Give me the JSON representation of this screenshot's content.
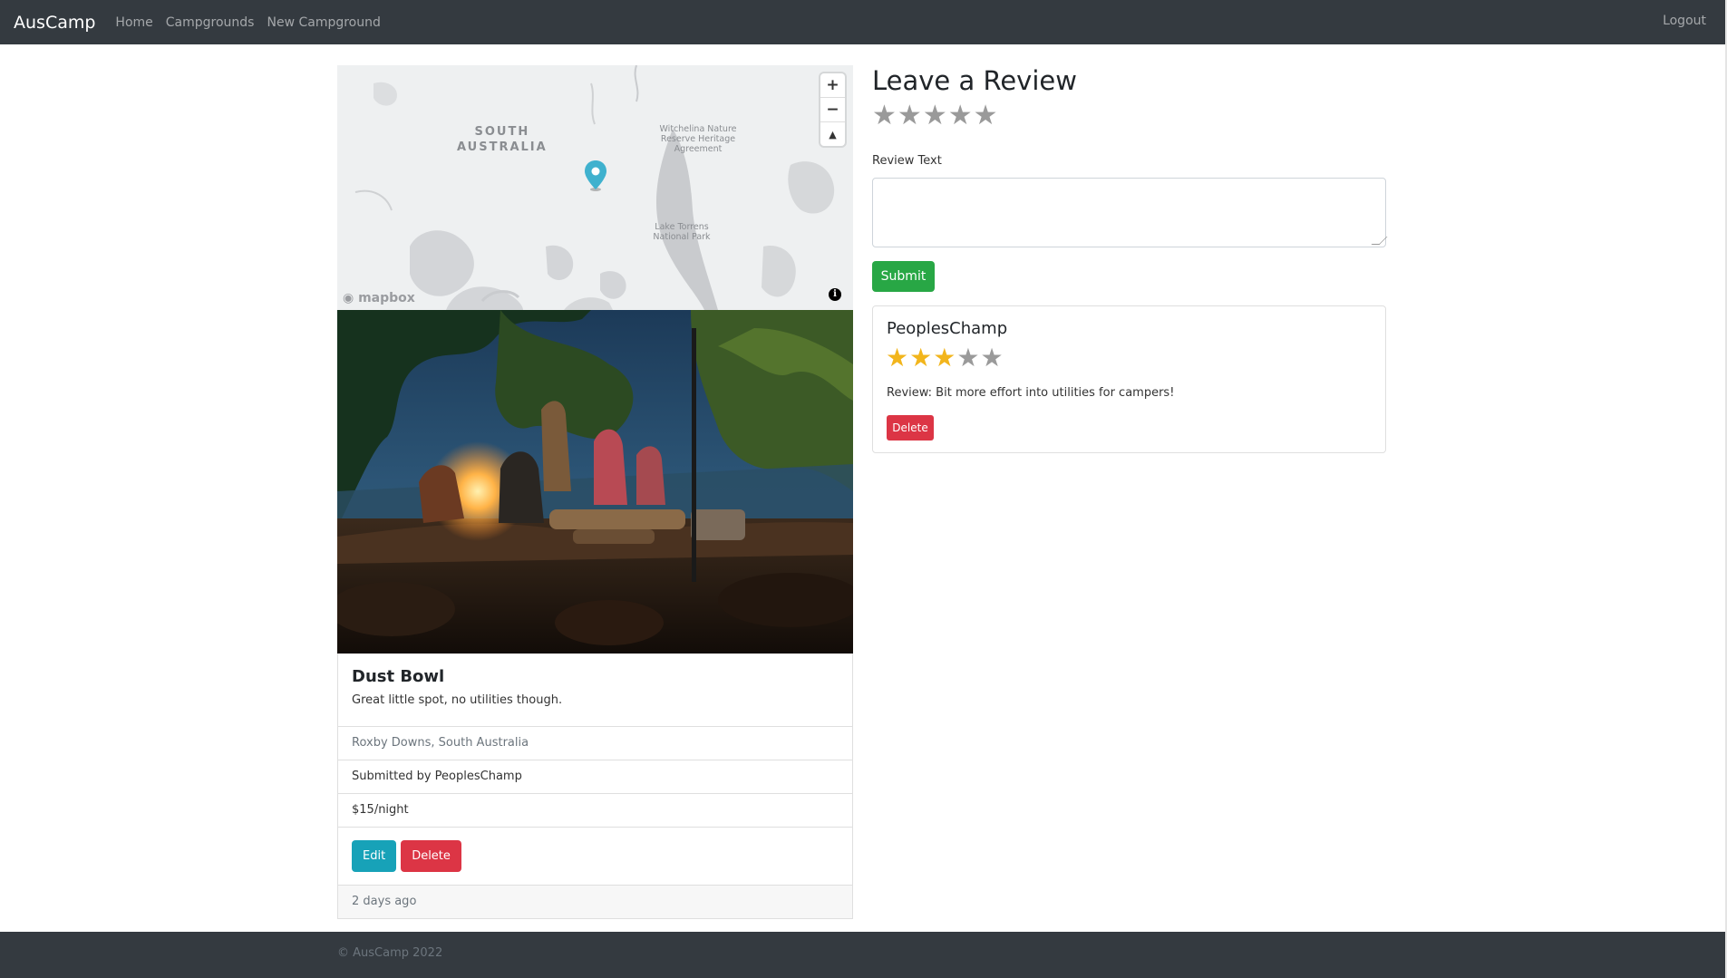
{
  "navbar": {
    "brand": "AusCamp",
    "links": [
      "Home",
      "Campgrounds",
      "New Campground"
    ],
    "logout": "Logout"
  },
  "map": {
    "region_label_line1": "SOUTH",
    "region_label_line2": "AUSTRALIA",
    "poi1_line1": "Witchelina Nature",
    "poi1_line2": "Reserve Heritage",
    "poi1_line3": "Agreement",
    "poi2_line1": "Lake Torrens",
    "poi2_line2": "National Park",
    "zoom_in": "+",
    "zoom_out": "−",
    "compass": "▲",
    "logo": "mapbox",
    "info": "i",
    "pin_color": "#3fb1ce"
  },
  "campground": {
    "title": "Dust Bowl",
    "description": "Great little spot, no utilities though.",
    "location": "Roxby Downs, South Australia",
    "submitted_by": "Submitted by PeoplesChamp",
    "price": "$15/night",
    "edit_label": "Edit",
    "delete_label": "Delete",
    "posted": "2 days ago"
  },
  "review_form": {
    "title": "Leave a Review",
    "rating_max": 5,
    "text_label": "Review Text",
    "text_value": "",
    "submit_label": "Submit"
  },
  "reviews": [
    {
      "author": "PeoplesChamp",
      "rating": 3,
      "rating_max": 5,
      "text": "Review: Bit more effort into utilities for campers!",
      "delete_label": "Delete"
    }
  ],
  "footer": {
    "text": "© AusCamp 2022"
  },
  "colors": {
    "navbar": "#343a40",
    "edit": "#17a2b8",
    "delete": "#dc3545",
    "submit": "#28a745",
    "star_on": "#f2b51c",
    "star_off": "#9a9a9a"
  }
}
